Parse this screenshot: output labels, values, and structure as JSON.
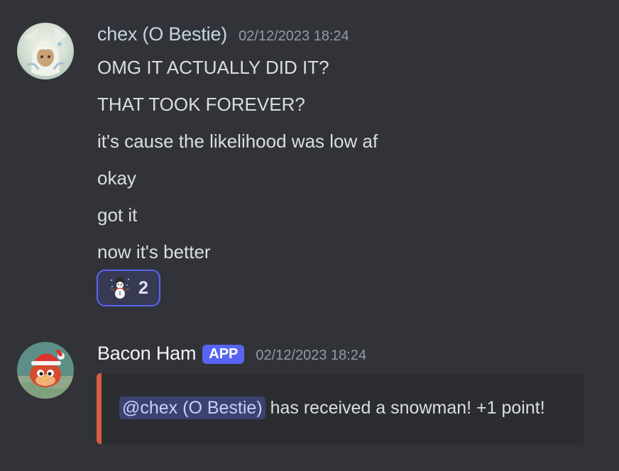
{
  "messages": [
    {
      "username": "chex (O Bestie)",
      "username_color": "#c6d4e1",
      "timestamp": "02/12/2023 18:24",
      "avatar": "anime-character-avatar",
      "lines": [
        "OMG IT ACTUALLY DID IT?",
        "THAT TOOK FOREVER?",
        "it's cause the likelihood was low af",
        "okay",
        "got it",
        "now it's better"
      ],
      "reaction": {
        "emoji": "snowman-icon",
        "count": "2"
      }
    },
    {
      "username": "Bacon Ham",
      "username_color": "#f2f3f5",
      "badge": "APP",
      "timestamp": "02/12/2023 18:24",
      "avatar": "bird-with-santa-hat-avatar",
      "embed": {
        "accent_color": "#da5b43",
        "mention": "@chex (O Bestie)",
        "text": " has received a snowman! +1 point!"
      }
    }
  ]
}
